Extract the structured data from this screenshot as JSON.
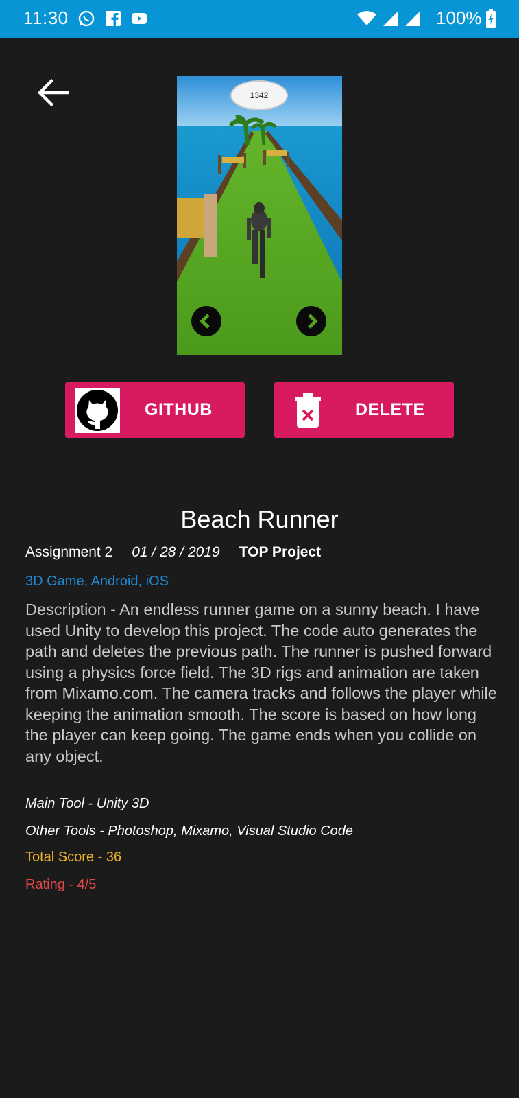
{
  "status_bar": {
    "time": "11:30",
    "battery": "100%",
    "icons": [
      "whatsapp-icon",
      "facebook-icon",
      "youtube-icon",
      "wifi-icon",
      "signal-icon",
      "signal-icon",
      "battery-charging-icon"
    ]
  },
  "screenshot": {
    "score": "1342"
  },
  "buttons": {
    "github_label": "GITHUB",
    "delete_label": "DELETE"
  },
  "project": {
    "title": "Beach Runner",
    "assignment": "Assignment 2",
    "date": "01 / 28 / 2019",
    "badge": "TOP Project",
    "tags": "3D Game, Android, iOS",
    "description": "Description - An endless runner game on a sunny beach. I have used Unity to develop this project. The code auto generates the path and deletes the previous path. The runner is pushed forward using a physics force field. The 3D rigs and animation are taken from Mixamo.com. The camera tracks and follows the player while keeping the animation smooth. The score is based on how long the player can keep going. The game ends when you collide on any object.",
    "main_tool": "Main Tool - Unity 3D",
    "other_tools": "Other Tools - Photoshop, Mixamo, Visual Studio Code",
    "total_score": "Total Score - 36",
    "rating": "Rating - 4/5"
  },
  "colors": {
    "status_bar": "#0795d6",
    "background": "#1b1b1c",
    "accent": "#d81b60",
    "tags": "#1e8ad6",
    "score": "#f0b429",
    "rating": "#e24a4a"
  }
}
